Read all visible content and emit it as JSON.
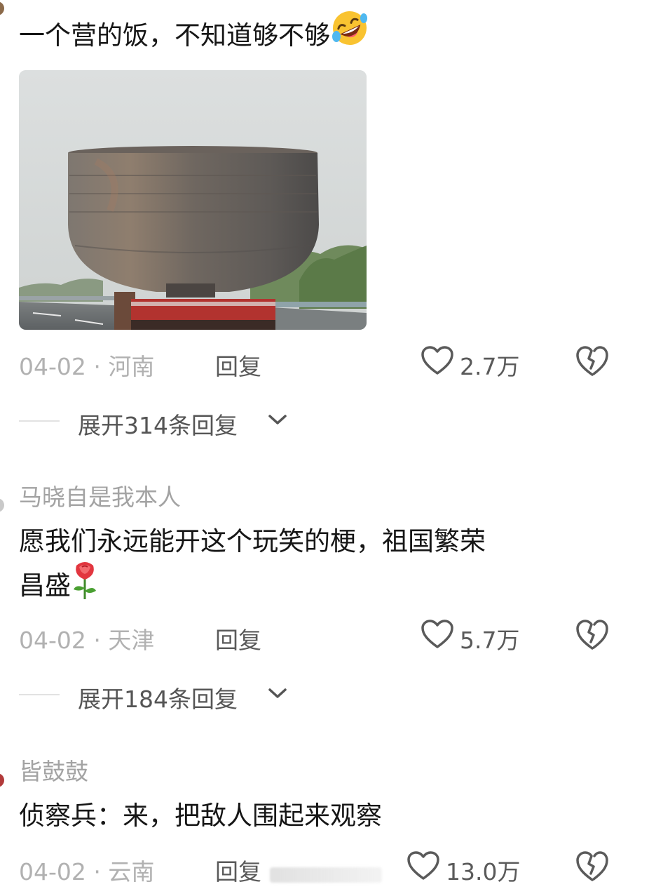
{
  "comments": [
    {
      "text": "一个营的饭，不知道够不够",
      "emoji": "rolling-on-floor-laughing",
      "date": "04-02 · 河南",
      "reply_label": "回复",
      "likes": "2.7万",
      "expand_label": "展开314条回复"
    },
    {
      "username": "马晓自是我本人",
      "text_line1": "愿我们永远能开这个玩笑的梗，祖国繁荣",
      "text_line2": "昌盛",
      "emoji": "rose",
      "date": "04-02 · 天津",
      "reply_label": "回复",
      "likes": "5.7万",
      "expand_label": "展开184条回复"
    },
    {
      "username": "皆鼓鼓",
      "text": "侦察兵：来，把敌人围起来观察",
      "date": "04-02 · 云南",
      "reply_label": "回复",
      "likes": "13.0万"
    }
  ],
  "icons": {
    "like": "heart-outline-icon",
    "dislike": "broken-heart-icon",
    "expand": "chevron-down-icon"
  },
  "colors": {
    "text_primary": "#161616",
    "text_muted": "#a3a3a3",
    "text_secondary": "#5a5a5a",
    "divider": "#e2e2e2"
  }
}
